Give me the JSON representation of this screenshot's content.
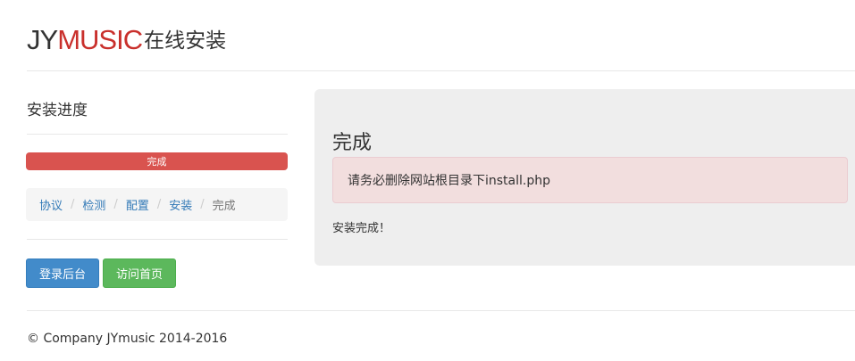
{
  "header": {
    "logo_prefix": "JY",
    "logo_brand": "MUSIC",
    "logo_suffix": "在线安装"
  },
  "sidebar": {
    "title": "安装进度",
    "progress": {
      "label": "完成",
      "percent": 100,
      "color": "#d9534f"
    },
    "steps": [
      {
        "label": "协议",
        "active": false
      },
      {
        "label": "检测",
        "active": false
      },
      {
        "label": "配置",
        "active": false
      },
      {
        "label": "安装",
        "active": false
      },
      {
        "label": "完成",
        "active": true
      }
    ],
    "separator": "/",
    "buttons": {
      "login": "登录后台",
      "home": "访问首页"
    }
  },
  "main": {
    "title": "完成",
    "alert": "请务必删除网站根目录下install.php",
    "message": "安装完成！"
  },
  "footer": {
    "text": "© Company JYmusic 2014-2016"
  },
  "colors": {
    "brand": "#c9302c",
    "primary": "#428bca",
    "success": "#5cb85c",
    "danger": "#d9534f"
  }
}
